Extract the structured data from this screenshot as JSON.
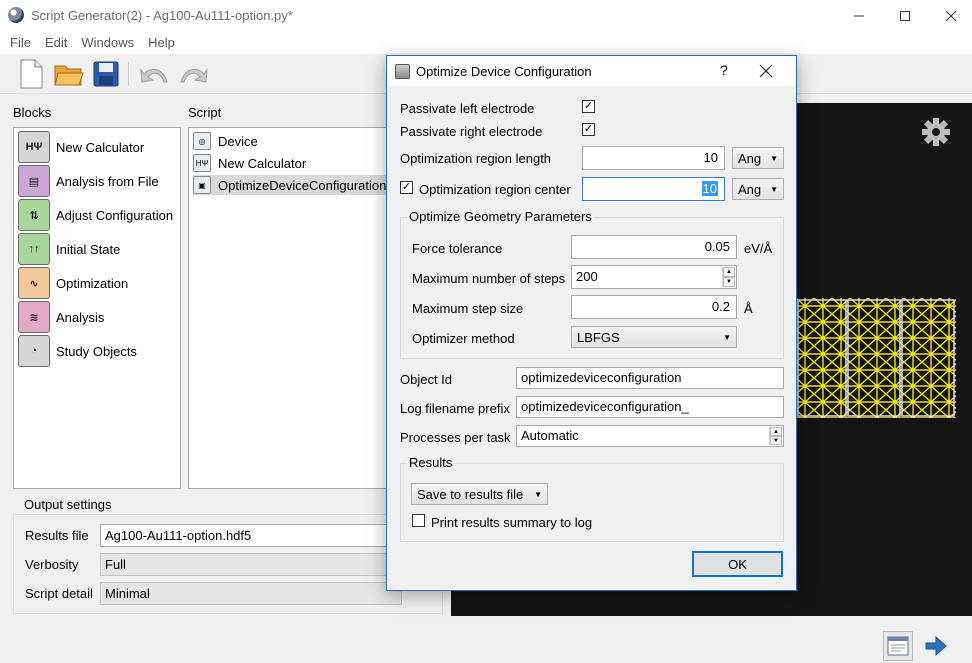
{
  "window": {
    "title": "Script Generator(2) - Ag100-Au111-option.py*"
  },
  "menu": [
    "File",
    "Edit",
    "Windows",
    "Help"
  ],
  "toolbar": {
    "icons": [
      "new-file-icon",
      "open-folder-icon",
      "save-disk-icon",
      "undo-icon",
      "redo-icon"
    ]
  },
  "blocks": {
    "label": "Blocks",
    "items": [
      {
        "label": "New Calculator",
        "icon": "HΨ",
        "color": "#d6d6d6"
      },
      {
        "label": "Analysis from File",
        "icon": "▤",
        "color": "#c9a8d9"
      },
      {
        "label": "Adjust Configuration",
        "icon": "⇅",
        "color": "#a8d69b"
      },
      {
        "label": "Initial State",
        "icon": "↑↑",
        "color": "#a8d69b"
      },
      {
        "label": "Optimization",
        "icon": "∿",
        "color": "#f2c79a"
      },
      {
        "label": "Analysis",
        "icon": "≋",
        "color": "#e3a9c6"
      },
      {
        "label": "Study Objects",
        "icon": "◔",
        "color": "#d6d6d6"
      }
    ]
  },
  "script": {
    "label": "Script",
    "items": [
      {
        "label": "Device",
        "icon": "◎"
      },
      {
        "label": "New Calculator",
        "icon": "HΨ"
      },
      {
        "label": "OptimizeDeviceConfiguration",
        "icon": "▣"
      }
    ]
  },
  "output": {
    "title": "Output settings",
    "results_label": "Results file",
    "results_value": "Ag100-Au111-option.hdf5",
    "verbosity_label": "Verbosity",
    "verbosity_value": "Full",
    "detail_label": "Script detail",
    "detail_value": "Minimal"
  },
  "dialog": {
    "title": "Optimize Device Configuration",
    "help": "?",
    "passivate_left": "Passivate left electrode",
    "passivate_right": "Passivate right electrode",
    "region_length_label": "Optimization region length",
    "region_length_value": "10",
    "region_length_unit": "Ang",
    "region_center_label": "Optimization region center",
    "region_center_value": "10",
    "region_center_unit": "Ang",
    "geometry_group": "Optimize Geometry Parameters",
    "force_label": "Force tolerance",
    "force_value": "0.05",
    "force_unit": "eV/Å",
    "steps_label": "Maximum number of steps",
    "steps_value": "200",
    "stepsize_label": "Maximum step size",
    "stepsize_value": "0.2",
    "stepsize_unit": "Å",
    "method_label": "Optimizer method",
    "method_value": "LBFGS",
    "objectid_label": "Object Id",
    "objectid_value": "optimizedeviceconfiguration",
    "logprefix_label": "Log filename prefix",
    "logprefix_value": "optimizedeviceconfiguration_",
    "processes_label": "Processes per task",
    "processes_value": "Automatic",
    "results_group": "Results",
    "save_value": "Save to results file",
    "print_summary": "Print results summary to log",
    "ok": "OK"
  },
  "colors": {
    "accent": "#0078d7",
    "viewer_bg": "#141414",
    "atoms": "#f2e21a"
  }
}
